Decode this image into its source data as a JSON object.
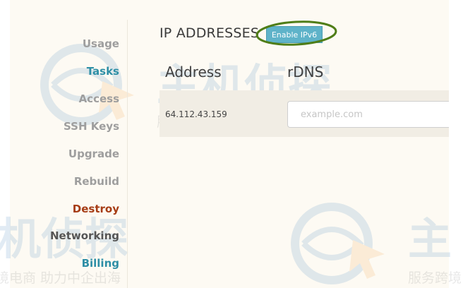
{
  "sidebar": {
    "items": [
      {
        "label": "Usage"
      },
      {
        "label": "Tasks"
      },
      {
        "label": "Access"
      },
      {
        "label": "SSH Keys"
      },
      {
        "label": "Upgrade"
      },
      {
        "label": "Rebuild"
      },
      {
        "label": "Destroy"
      },
      {
        "label": "Networking"
      },
      {
        "label": "Billing"
      }
    ]
  },
  "main": {
    "section_title": "IP ADDRESSES",
    "enable_ipv6_label": "Enable IPv6",
    "columns": {
      "address": "Address",
      "rdns": "rDNS"
    },
    "ip_rows": [
      {
        "address": "64.112.43.159",
        "rdns_value": "",
        "rdns_placeholder": "example.com"
      }
    ]
  },
  "watermark": {
    "big": "主机侦探",
    "line": "服务跨境电商 助力中企出海",
    "line_left": "境电商 助力中企出海",
    "line_right": "服务跨境",
    "big_left": "机侦探",
    "big_right": "主"
  },
  "colors": {
    "accent": "#2e8fa6",
    "danger": "#a63c15",
    "button": "#5fb3c9",
    "annotation": "#4f7d17"
  }
}
